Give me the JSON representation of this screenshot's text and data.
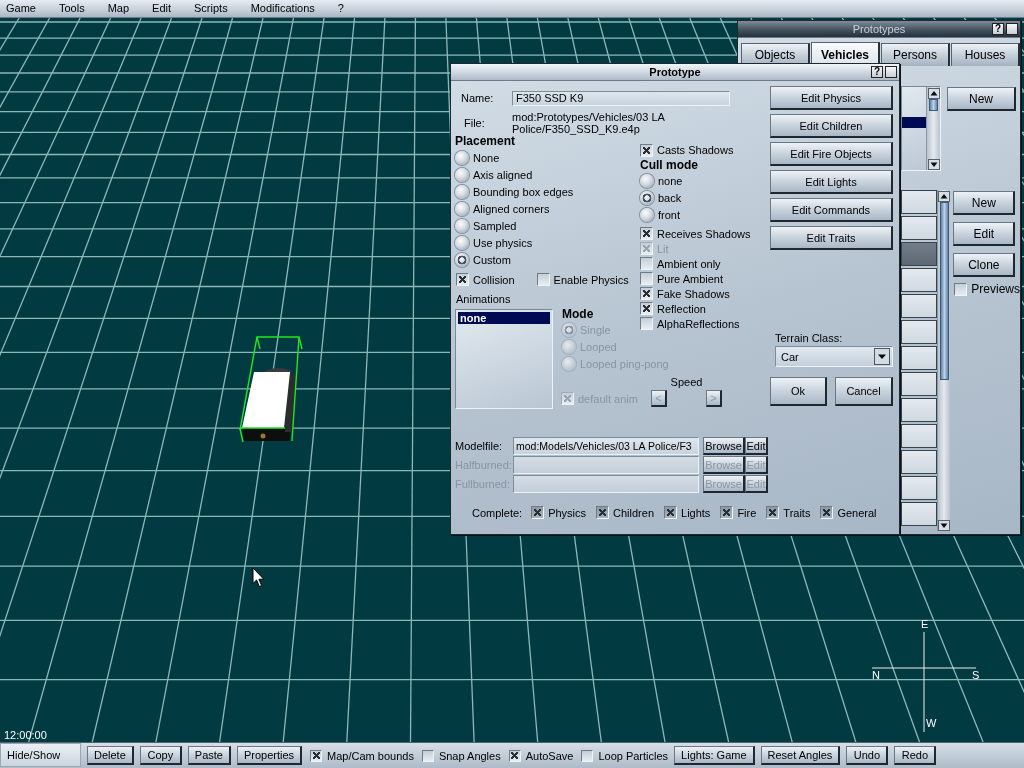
{
  "menu_bar": {
    "items": [
      {
        "label": "Game"
      },
      {
        "label": "Tools"
      },
      {
        "label": "Map"
      },
      {
        "label": "Edit"
      },
      {
        "label": "Scripts"
      },
      {
        "label": "Modifications"
      },
      {
        "label": "?"
      }
    ]
  },
  "viewport": {
    "time": "12:00:00",
    "compass": {
      "top": "E",
      "left": "N",
      "right": "S",
      "bottom": "W"
    }
  },
  "prototypes_window": {
    "title": "Prototypes",
    "active": false,
    "help": "?",
    "tabs": [
      {
        "label": "Objects",
        "selected": false
      },
      {
        "label": "Vehicles",
        "selected": true
      },
      {
        "label": "Persons",
        "selected": false
      },
      {
        "label": "Houses",
        "selected": false
      }
    ],
    "category_list": {
      "rows": [
        {
          "selected": true
        }
      ]
    },
    "category_buttons": [
      {
        "label": "New"
      }
    ],
    "prototype_list": {
      "rows": [
        {
          "selected": false
        },
        {
          "selected": false
        },
        {
          "selected": true
        },
        {
          "selected": false
        },
        {
          "selected": false
        },
        {
          "selected": false
        },
        {
          "selected": false
        },
        {
          "selected": false
        },
        {
          "selected": false
        },
        {
          "selected": false
        },
        {
          "selected": false
        },
        {
          "selected": false
        },
        {
          "selected": false
        }
      ]
    },
    "prototype_buttons": [
      {
        "label": "New"
      },
      {
        "label": "Edit"
      },
      {
        "label": "Clone"
      }
    ],
    "previews": {
      "label": "Previews",
      "checked": false
    }
  },
  "prototype_dialog": {
    "title": "Prototype",
    "active": true,
    "help": "?",
    "name": {
      "label": "Name:",
      "value": "F350 SSD K9"
    },
    "file": {
      "label": "File:",
      "value": "mod:Prototypes/Vehicles/03 LA Police/F350_SSD_K9.e4p"
    },
    "placement": {
      "title": "Placement",
      "options": [
        {
          "label": "None",
          "selected": false
        },
        {
          "label": "Axis aligned",
          "selected": false
        },
        {
          "label": "Bounding box edges",
          "selected": false
        },
        {
          "label": "Aligned corners",
          "selected": false
        },
        {
          "label": "Sampled",
          "selected": false
        },
        {
          "label": "Use physics",
          "selected": false
        },
        {
          "label": "Custom",
          "selected": true
        }
      ]
    },
    "physics_options": [
      {
        "label": "Collision",
        "checked": true
      },
      {
        "label": "Enable Physics",
        "checked": false
      }
    ],
    "casts_shadows": {
      "label": "Casts Shadows",
      "checked": true
    },
    "cull_mode": {
      "title": "Cull mode",
      "options": [
        {
          "label": "none",
          "selected": false
        },
        {
          "label": "back",
          "selected": true
        },
        {
          "label": "front",
          "selected": false
        }
      ]
    },
    "render_options": [
      {
        "label": "Receives Shadows",
        "checked": true,
        "disabled": false
      },
      {
        "label": "Lit",
        "checked": true,
        "disabled": true
      },
      {
        "label": "Ambient only",
        "checked": false,
        "disabled": false
      },
      {
        "label": "Pure Ambient",
        "checked": false,
        "disabled": false
      },
      {
        "label": "Fake Shadows",
        "checked": true,
        "disabled": false
      },
      {
        "label": "Reflection",
        "checked": true,
        "disabled": false
      },
      {
        "label": "AlphaReflections",
        "checked": false,
        "disabled": false
      }
    ],
    "animations": {
      "label": "Animations",
      "items": [
        {
          "label": "none",
          "selected": true
        }
      ]
    },
    "mode": {
      "title": "Mode",
      "disabled": true,
      "options": [
        {
          "label": "Single",
          "selected": true
        },
        {
          "label": "Looped",
          "selected": false
        },
        {
          "label": "Looped ping-pong",
          "selected": false
        }
      ]
    },
    "default_anim": {
      "label": "default anim",
      "checked": true
    },
    "speed": {
      "label": "Speed",
      "decrease": "<",
      "increase": ">",
      "disabled": true
    },
    "edit_buttons": [
      {
        "label": "Edit Physics"
      },
      {
        "label": "Edit Children"
      },
      {
        "label": "Edit Fire Objects"
      },
      {
        "label": "Edit Lights"
      },
      {
        "label": "Edit Commands"
      },
      {
        "label": "Edit Traits"
      }
    ],
    "terrain_class": {
      "label": "Terrain Class:",
      "value": "Car"
    },
    "actions": [
      {
        "label": "Ok"
      },
      {
        "label": "Cancel"
      }
    ],
    "model_files": [
      {
        "label": "Modelfile:",
        "value": "mod:Models/Vehicles/03 LA Police/F3",
        "disabled": false,
        "browse": "Browse",
        "edit": "Edit"
      },
      {
        "label": "Halfburned:",
        "disabled": true,
        "browse": "Browse",
        "edit": "Edit"
      },
      {
        "label": "Fullburned:",
        "disabled": true,
        "browse": "Browse",
        "edit": "Edit"
      }
    ],
    "complete": {
      "label": "Complete:",
      "items": [
        {
          "label": "Physics",
          "checked": true
        },
        {
          "label": "Children",
          "checked": true
        },
        {
          "label": "Lights",
          "checked": true
        },
        {
          "label": "Fire",
          "checked": true
        },
        {
          "label": "Traits",
          "checked": true
        },
        {
          "label": "General",
          "checked": true
        }
      ]
    }
  },
  "toolbar": {
    "items": [
      {
        "kind": "toggle",
        "label": "Hide/Show"
      },
      {
        "kind": "button",
        "label": "Delete"
      },
      {
        "kind": "button",
        "label": "Copy"
      },
      {
        "kind": "button",
        "label": "Paste"
      },
      {
        "kind": "button",
        "label": "Properties"
      },
      {
        "kind": "checkbox",
        "label": "Map/Cam bounds",
        "checked": true
      },
      {
        "kind": "checkbox",
        "label": "Snap Angles",
        "checked": false
      },
      {
        "kind": "checkbox",
        "label": "AutoSave",
        "checked": true
      },
      {
        "kind": "checkbox",
        "label": "Loop Particles",
        "checked": false
      },
      {
        "kind": "button",
        "label": "Lights: Game"
      },
      {
        "kind": "button",
        "label": "Reset Angles"
      },
      {
        "kind": "button",
        "label": "Undo"
      },
      {
        "kind": "button",
        "label": "Redo"
      }
    ]
  }
}
